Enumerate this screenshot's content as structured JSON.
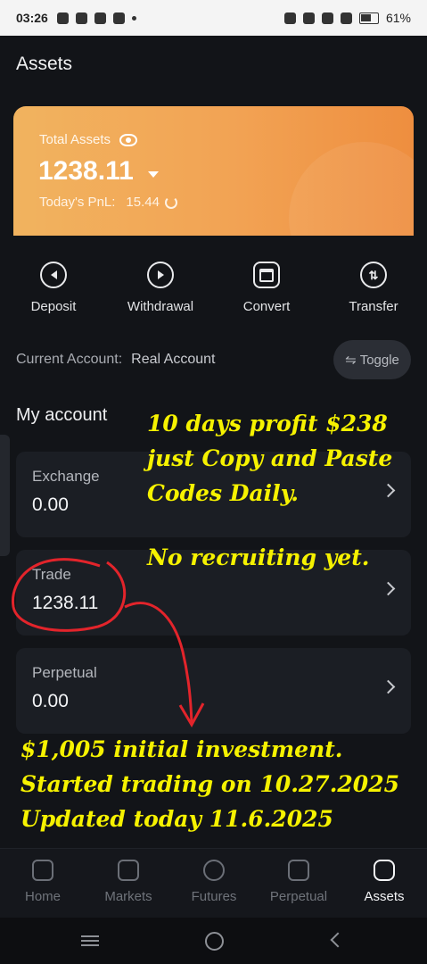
{
  "status_bar": {
    "time": "03:26",
    "battery": "61%"
  },
  "page": {
    "title": "Assets"
  },
  "asset_card": {
    "label": "Total Assets",
    "total": "1238.11",
    "pnl_label": "Today's PnL:",
    "pnl_value": "15.44"
  },
  "actions": [
    {
      "label": "Deposit",
      "icon": "deposit-icon"
    },
    {
      "label": "Withdrawal",
      "icon": "withdrawal-icon"
    },
    {
      "label": "Convert",
      "icon": "convert-icon"
    },
    {
      "label": "Transfer",
      "icon": "transfer-icon"
    }
  ],
  "current_account": {
    "label": "Current Account:",
    "value": "Real Account",
    "toggle_label": "Toggle"
  },
  "my_account": {
    "title": "My account",
    "accounts": [
      {
        "name": "Exchange",
        "amount": "0.00"
      },
      {
        "name": "Trade",
        "amount": "1238.11"
      },
      {
        "name": "Perpetual",
        "amount": "0.00"
      }
    ]
  },
  "overlay": {
    "text1": "10 days profit $238\njust Copy and Paste\nCodes Daily.",
    "text2": "No recruiting yet.",
    "text3": "$1,005 initial investment.\nStarted trading on 10.27.2025\nUpdated today 11.6.2025",
    "color": "#f6f200",
    "annotation_color": "#e3242b"
  },
  "bottom_nav": [
    {
      "label": "Home",
      "icon": "home-icon",
      "active": false
    },
    {
      "label": "Markets",
      "icon": "markets-icon",
      "active": false
    },
    {
      "label": "Futures",
      "icon": "futures-icon",
      "active": false
    },
    {
      "label": "Perpetual",
      "icon": "perpetual-icon",
      "active": false
    },
    {
      "label": "Assets",
      "icon": "wallet-icon",
      "active": true
    }
  ],
  "colors": {
    "background": "#121418",
    "card": "#1b1e24",
    "accent_orange": "#f2a354"
  }
}
